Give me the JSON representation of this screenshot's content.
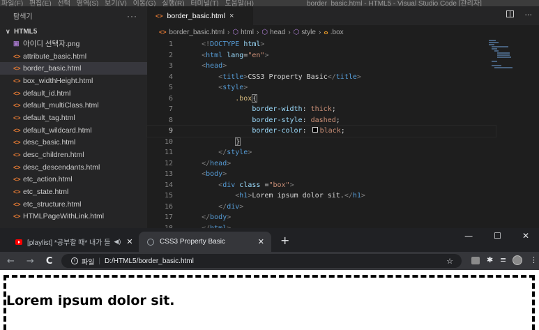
{
  "vscode": {
    "menu": "파일(F)  편집(E)  선택 영역(S)  보기(V)  이동(G)  실행(R)  터미널(T)  도움말(H)",
    "window_title": "border_basic.html - HTML5 - Visual Studio Code [관리자]",
    "sidebar": {
      "title": "탐색기",
      "more": "···",
      "folder": "HTML5",
      "files": [
        {
          "name": "아이디 선택자.png",
          "type": "image",
          "active": false
        },
        {
          "name": "attribute_basic.html",
          "type": "html",
          "active": false
        },
        {
          "name": "border_basic.html",
          "type": "html",
          "active": true
        },
        {
          "name": "box_widthHeight.html",
          "type": "html",
          "active": false
        },
        {
          "name": "default_id.html",
          "type": "html",
          "active": false
        },
        {
          "name": "default_multiClass.html",
          "type": "html",
          "active": false
        },
        {
          "name": "default_tag.html",
          "type": "html",
          "active": false
        },
        {
          "name": "default_wildcard.html",
          "type": "html",
          "active": false
        },
        {
          "name": "desc_basic.html",
          "type": "html",
          "active": false
        },
        {
          "name": "desc_children.html",
          "type": "html",
          "active": false
        },
        {
          "name": "desc_descendants.html",
          "type": "html",
          "active": false
        },
        {
          "name": "etc_action.html",
          "type": "html",
          "active": false
        },
        {
          "name": "etc_state.html",
          "type": "html",
          "active": false
        },
        {
          "name": "etc_structure.html",
          "type": "html",
          "active": false
        },
        {
          "name": "HTMLPageWithLink.html",
          "type": "html",
          "active": false
        }
      ]
    },
    "tab": {
      "label": "border_basic.html",
      "close": "×"
    },
    "breadcrumb": [
      "border_basic.html",
      "html",
      "head",
      "style",
      ".box"
    ],
    "current_line": 9
  },
  "browser": {
    "tabs": [
      {
        "label": "[playlist] *공부할 때* 내가 들",
        "active": false
      },
      {
        "label": "CSS3 Property Basic",
        "active": true
      }
    ],
    "address_prefix": "파일",
    "address": "D:/HTML5/border_basic.html",
    "page_heading": "Lorem ipsum dolor sit."
  }
}
